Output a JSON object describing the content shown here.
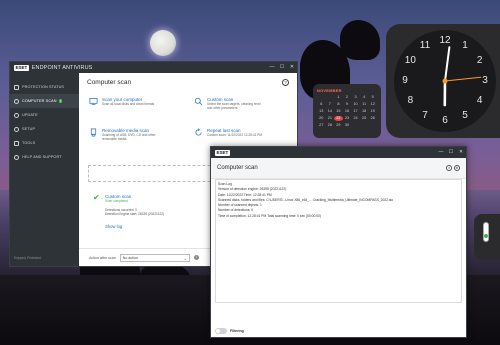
{
  "main_window": {
    "title": "ENDPOINT ANTIVIRUS",
    "logo": "ESET",
    "controls": [
      "—",
      "☐",
      "✕"
    ],
    "sidebar": {
      "items": [
        {
          "label": "PROTECTION STATUS",
          "icon": "shield-icon",
          "active": false,
          "badge": ""
        },
        {
          "label": "COMPUTER SCAN",
          "icon": "magnifier-icon",
          "active": true,
          "badge": "1"
        },
        {
          "label": "UPDATE",
          "icon": "refresh-icon",
          "active": false,
          "badge": ""
        },
        {
          "label": "SETUP",
          "icon": "gear-icon",
          "active": false,
          "badge": ""
        },
        {
          "label": "TOOLS",
          "icon": "briefcase-icon",
          "active": false,
          "badge": ""
        },
        {
          "label": "HELP AND SUPPORT",
          "icon": "help-icon",
          "active": false,
          "badge": ""
        }
      ],
      "footer": "Enjoyed, Protected"
    },
    "content": {
      "title": "Computer scan",
      "help": "?",
      "options": [
        {
          "label": "Scan your computer",
          "desc": "Scan all local disks and clean threats"
        },
        {
          "label": "Custom scan",
          "desc": "Select the scan targets, cleaning level and other parameters"
        },
        {
          "label": "Removable media scan",
          "desc": "Scanning of USB, DVD, CD and other removable media"
        },
        {
          "label": "Repeat last scan",
          "desc": "Custom scan: 11/22/2022 12:28:41 PM"
        }
      ],
      "dropzone": "Drag and drop files here to",
      "result": {
        "title": "Custom scan",
        "status": "Scan completed",
        "detections": "Detections occurred: 0",
        "engine": "Detection Engine start: 26335 (20221122)",
        "show_log": "Show log"
      },
      "footer": {
        "after_label": "Action after scan",
        "after_value": "No action",
        "info": "i"
      }
    }
  },
  "log_window": {
    "logo": "ESET",
    "header_title": "Computer scan",
    "controls": [
      "—",
      "☐",
      "✕"
    ],
    "tools": [
      "≡",
      "⊕"
    ],
    "lines": [
      "Scan Log",
      "Version of detection engine: 26395 (20221122)",
      "Date: 11/22/2022  Time: 12:28:41 PM",
      "Scanned disks, folders and files: C:\\USERS\\...Linux X86_x64_... Cracking_Multimedia_Ultimate_INCOMPASS_2022.iso",
      "Number of scanned objects: 1",
      "Number of detections: 0",
      "Time of completion: 12:28:41 PM  Total scanning time: 0 sec (00:00:00)"
    ],
    "filter_label": "Filtering"
  },
  "clock": {
    "numbers": [
      "12",
      "1",
      "2",
      "3",
      "4",
      "5",
      "6",
      "7",
      "8",
      "9",
      "10",
      "11"
    ],
    "hour": 6,
    "minute": 1,
    "second": 14
  },
  "calendar": {
    "month": "NOVEMBER",
    "days": [
      "",
      "",
      "1",
      "2",
      "3",
      "4",
      "5",
      "6",
      "7",
      "8",
      "9",
      "10",
      "11",
      "12",
      "13",
      "14",
      "15",
      "16",
      "17",
      "18",
      "19",
      "20",
      "21",
      "22",
      "23",
      "24",
      "25",
      "26",
      "27",
      "28",
      "29",
      "30",
      "",
      "",
      "",
      ""
    ],
    "today": "22"
  },
  "colors": {
    "accent_green": "#3eb449",
    "link_blue": "#1e6cc7",
    "sidebar": "#2e3337",
    "today_red": "#e84545"
  }
}
